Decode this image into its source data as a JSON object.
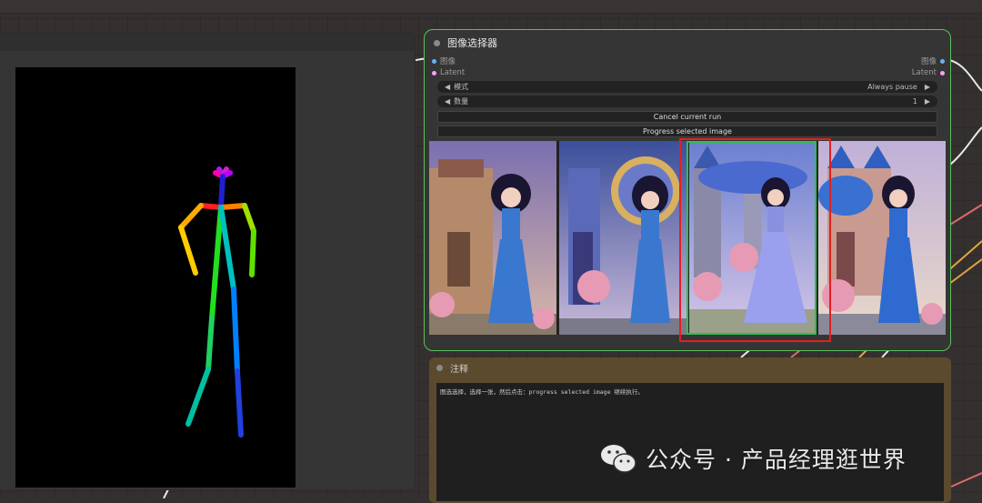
{
  "canvas": {
    "background": "#353030"
  },
  "selector_node": {
    "title": "图像选择器",
    "input_image": "图像",
    "input_latent": "Latent",
    "output_image": "图像",
    "output_latent": "Latent",
    "mode_label": "模式",
    "mode_value": "Always pause",
    "count_label": "数量",
    "count_value": "1",
    "cancel_button": "Cancel current run",
    "progress_button": "Progress selected image",
    "border_color": "#5bbf5b",
    "selected_index": 2
  },
  "note_node": {
    "title": "注释",
    "text": "图选选择，选择一张，然后点击：progress selected image  继续执行。"
  },
  "watermark": {
    "text": "公众号 · 产品经理逛世界"
  },
  "icons": [
    "wechat-icon",
    "left-arrow-icon",
    "right-arrow-icon"
  ],
  "colors": {
    "highlight_red": "#e02020",
    "selected_green": "#2fbf4f",
    "note_bg": "#5c4a2e"
  }
}
